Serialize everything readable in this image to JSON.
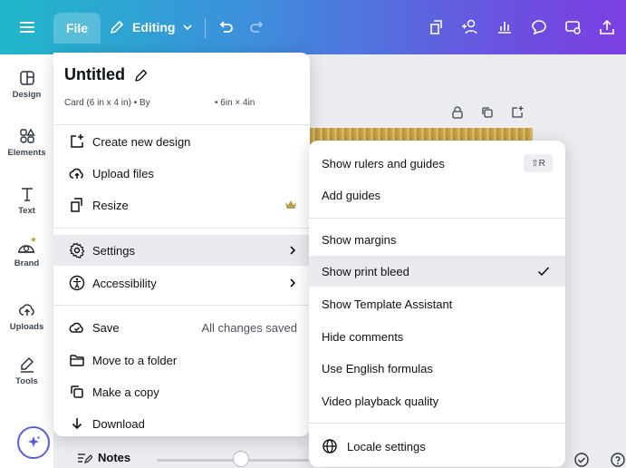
{
  "topbar": {
    "file_label": "File",
    "editing_label": "Editing",
    "gradient": [
      "#20b8c9",
      "#7b3fe2"
    ]
  },
  "rail": {
    "items": [
      {
        "label": "Design",
        "icon": "layout-icon"
      },
      {
        "label": "Elements",
        "icon": "shapes-icon"
      },
      {
        "label": "Text",
        "icon": "text-icon"
      },
      {
        "label": "Brand",
        "icon": "brand-icon"
      },
      {
        "label": "Uploads",
        "icon": "cloud-upload-icon"
      },
      {
        "label": "Tools",
        "icon": "pen-tool-icon"
      }
    ]
  },
  "file_menu": {
    "title": "Untitled",
    "subtitle": "Card (6 in x 4 in) • By",
    "size": "• 6in × 4in",
    "items": [
      {
        "label": "Create new design",
        "icon": "plus-square-icon"
      },
      {
        "label": "Upload files",
        "icon": "cloud-upload-icon"
      },
      {
        "label": "Resize",
        "icon": "resize-icon"
      },
      {
        "label": "Settings",
        "icon": "gear-icon"
      },
      {
        "label": "Accessibility",
        "icon": "accessibility-icon"
      },
      {
        "label": "Save",
        "icon": "cloud-check-icon",
        "status": "All changes saved"
      },
      {
        "label": "Move to a folder",
        "icon": "folder-icon"
      },
      {
        "label": "Make a copy",
        "icon": "copy-icon"
      },
      {
        "label": "Download",
        "icon": "download-icon"
      }
    ]
  },
  "settings_menu": {
    "items": [
      {
        "label": "Show rulers and guides",
        "shortcut": "⇧R"
      },
      {
        "label": "Add guides"
      },
      {
        "label": "Show margins"
      },
      {
        "label": "Show print bleed",
        "checked": true
      },
      {
        "label": "Show Template Assistant"
      },
      {
        "label": "Hide comments"
      },
      {
        "label": "Use English formulas"
      },
      {
        "label": "Video playback quality"
      },
      {
        "label": "Locale settings",
        "icon": "globe-icon"
      }
    ]
  },
  "bottombar": {
    "notes_label": "Notes"
  }
}
